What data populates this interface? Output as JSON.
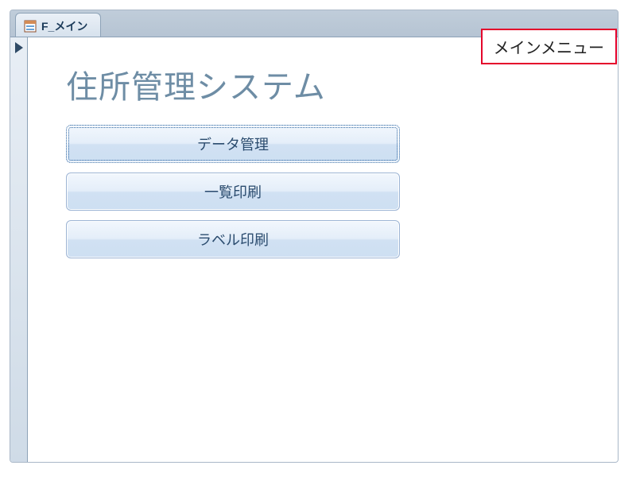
{
  "tab": {
    "label": "F_メイン"
  },
  "form": {
    "title": "住所管理システム",
    "buttons": [
      {
        "label": "データ管理"
      },
      {
        "label": "一覧印刷"
      },
      {
        "label": "ラベル印刷"
      }
    ]
  },
  "annotation": {
    "label": "メインメニュー"
  }
}
